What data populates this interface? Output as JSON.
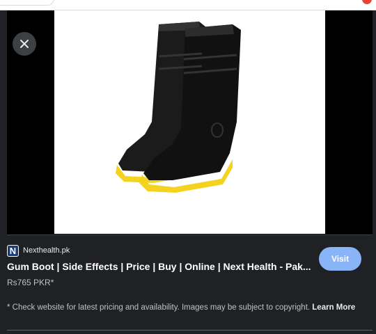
{
  "source": {
    "favicon_letter": "N",
    "name": "Nexthealth.pk"
  },
  "result": {
    "title": "Gum Boot | Side Effects | Price | Buy | Online | Next Health - Pak...",
    "price": "Rs765 PKR*"
  },
  "actions": {
    "visit_label": "Visit",
    "close_icon": "close-icon"
  },
  "disclaimer": {
    "text": "* Check website for latest pricing and availability. Images may be subject to copyright. ",
    "learn_more": "Learn More"
  },
  "colors": {
    "background": "#202124",
    "visit_button": "#8ab4f8",
    "boot_black": "#1b1b1b",
    "boot_sole": "#f4d21f"
  }
}
